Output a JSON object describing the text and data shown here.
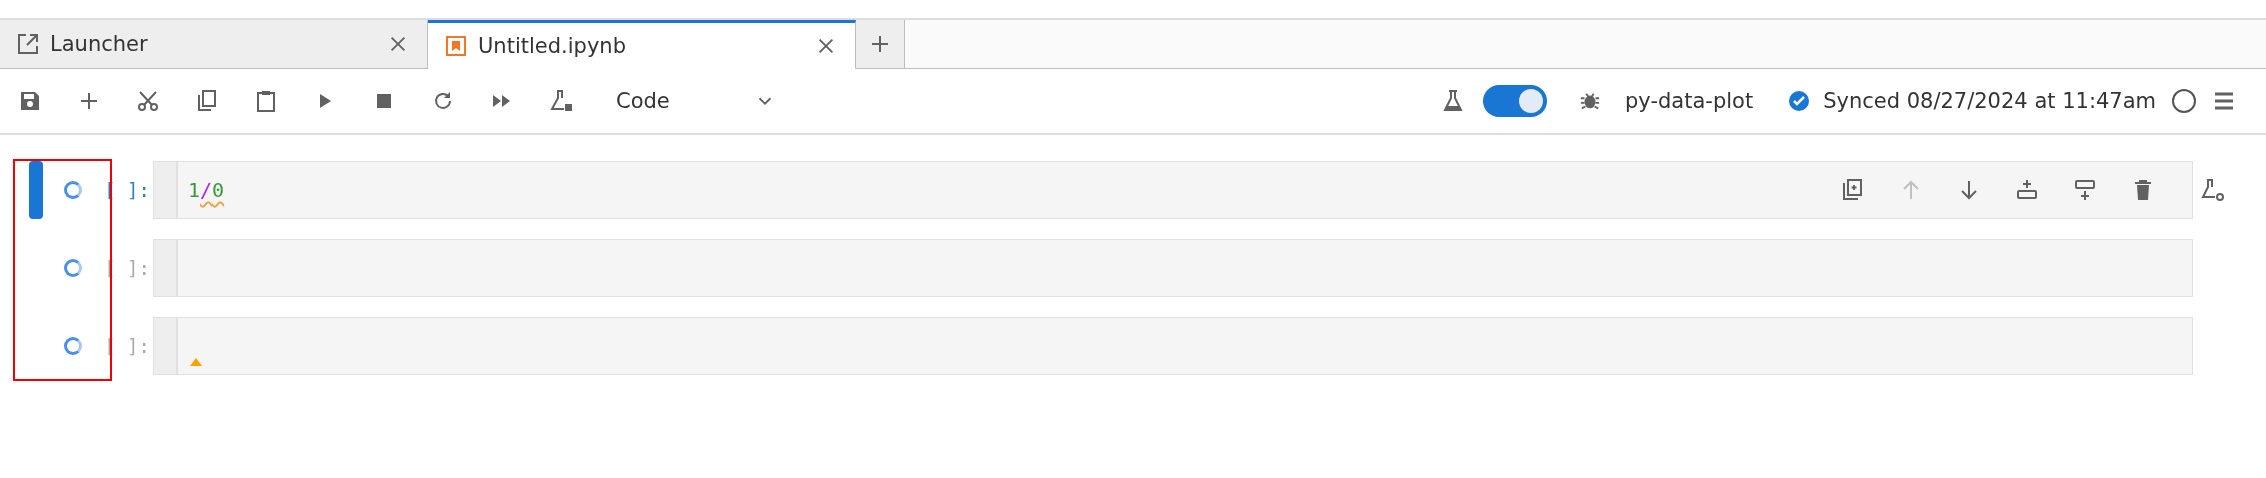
{
  "tabs": [
    {
      "label": "Launcher",
      "kind": "launcher",
      "selected": false
    },
    {
      "label": "Untitled.ipynb",
      "kind": "notebook",
      "selected": true
    }
  ],
  "toolbar": {
    "cell_type": "Code",
    "toggle_on": true,
    "kernel_name": "py-data-plot",
    "sync_status": "Synced 08/27/2024 at 11:47am",
    "kernel_busy": false
  },
  "cells": [
    {
      "prompt": "[ ]:",
      "selected": true,
      "tokens": [
        {
          "text": "1",
          "kind": "number",
          "squiggle": false
        },
        {
          "text": "/",
          "kind": "operator",
          "squiggle": true
        },
        {
          "text": "0",
          "kind": "number",
          "squiggle": true
        }
      ],
      "cursor_marker": false,
      "cell_toolbar": [
        {
          "kind": "duplicate",
          "disabled": false
        },
        {
          "kind": "move-up",
          "disabled": true
        },
        {
          "kind": "move-down",
          "disabled": false
        },
        {
          "kind": "insert-above",
          "disabled": false
        },
        {
          "kind": "insert-below",
          "disabled": false
        },
        {
          "kind": "delete",
          "disabled": false
        }
      ]
    },
    {
      "prompt": "[ ]:",
      "selected": false,
      "cursor_marker": false
    },
    {
      "prompt": "[ ]:",
      "selected": false,
      "cursor_marker": true
    }
  ]
}
